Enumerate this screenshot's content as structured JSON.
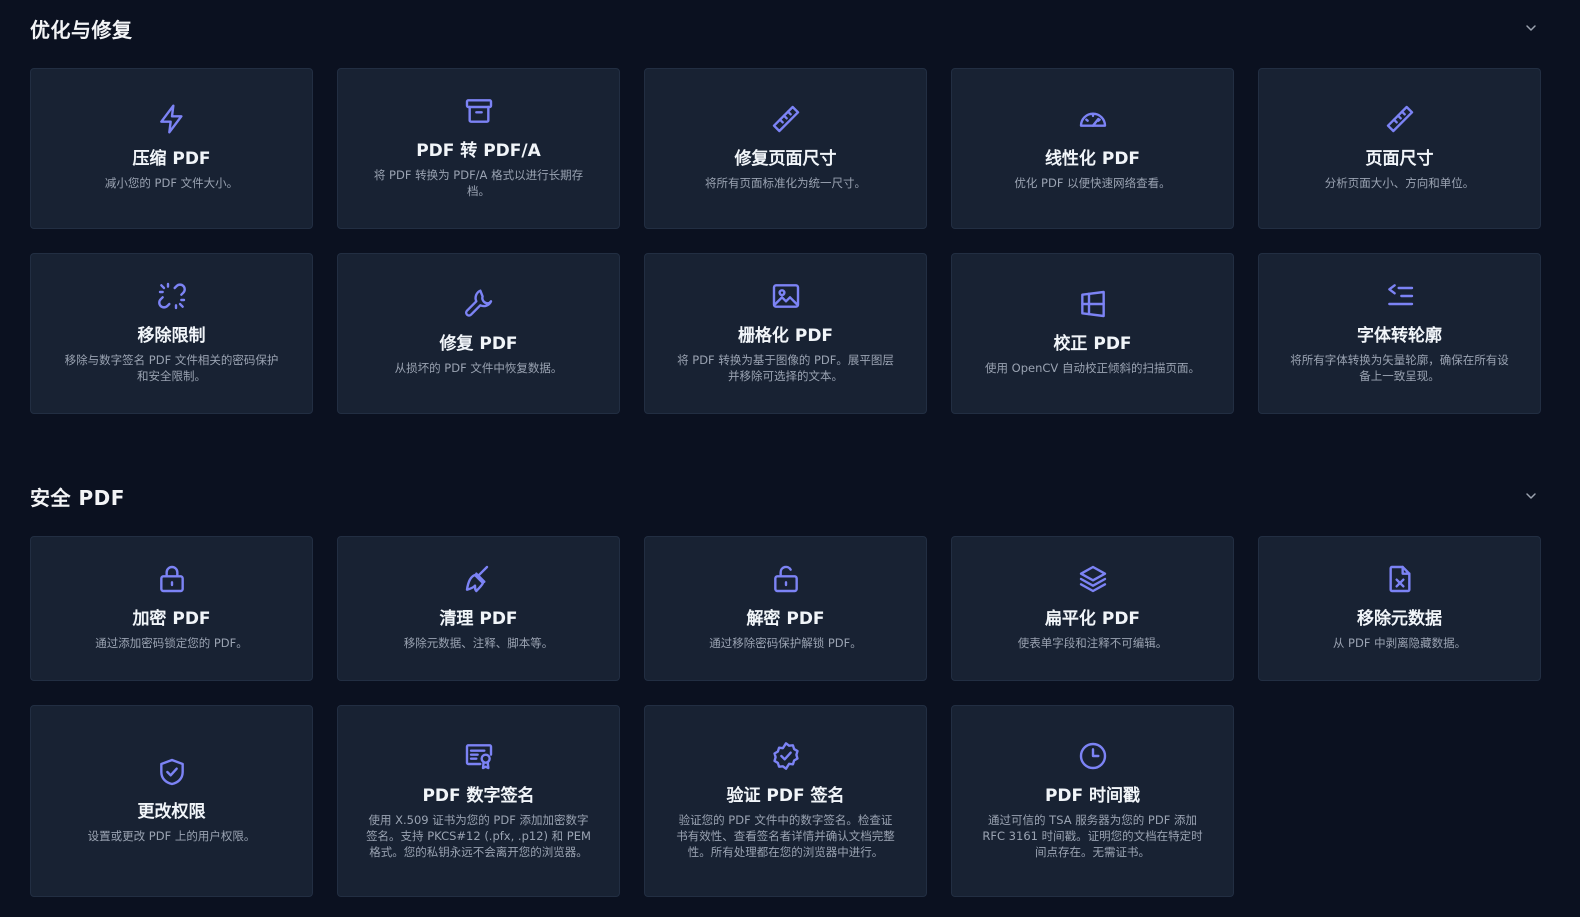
{
  "sections": [
    {
      "title": "优化与修复",
      "cards": [
        {
          "title": "压缩 PDF",
          "desc": "减小您的 PDF 文件大小。",
          "icon": "lightning-icon"
        },
        {
          "title": "PDF 转 PDF/A",
          "desc": "将 PDF 转换为 PDF/A 格式以进行长期存档。",
          "icon": "archive-icon"
        },
        {
          "title": "修复页面尺寸",
          "desc": "将所有页面标准化为统一尺寸。",
          "icon": "ruler-icon"
        },
        {
          "title": "线性化 PDF",
          "desc": "优化 PDF 以便快速网络查看。",
          "icon": "gauge-icon"
        },
        {
          "title": "页面尺寸",
          "desc": "分析页面大小、方向和单位。",
          "icon": "ruler-icon"
        },
        {
          "title": "移除限制",
          "desc": "移除与数字签名 PDF 文件相关的密码保护和安全限制。",
          "icon": "unlink-icon"
        },
        {
          "title": "修复 PDF",
          "desc": "从损坏的 PDF 文件中恢复数据。",
          "icon": "wrench-icon"
        },
        {
          "title": "栅格化 PDF",
          "desc": "将 PDF 转换为基于图像的 PDF。展平图层并移除可选择的文本。",
          "icon": "image-icon"
        },
        {
          "title": "校正 PDF",
          "desc": "使用 OpenCV 自动校正倾斜的扫描页面。",
          "icon": "perspective-icon"
        },
        {
          "title": "字体转轮廓",
          "desc": "将所有字体转换为矢量轮廓，确保在所有设备上一致呈现。",
          "icon": "indent-list-icon"
        }
      ]
    },
    {
      "title": "安全 PDF",
      "cards": [
        {
          "title": "加密 PDF",
          "desc": "通过添加密码锁定您的 PDF。",
          "icon": "lock-icon"
        },
        {
          "title": "清理 PDF",
          "desc": "移除元数据、注释、脚本等。",
          "icon": "broom-icon"
        },
        {
          "title": "解密 PDF",
          "desc": "通过移除密码保护解锁 PDF。",
          "icon": "unlock-icon"
        },
        {
          "title": "扁平化 PDF",
          "desc": "使表单字段和注释不可编辑。",
          "icon": "layers-icon"
        },
        {
          "title": "移除元数据",
          "desc": "从 PDF 中剥离隐藏数据。",
          "icon": "file-x-icon"
        },
        {
          "title": "更改权限",
          "desc": "设置或更改 PDF 上的用户权限。",
          "icon": "shield-check-icon"
        },
        {
          "title": "PDF 数字签名",
          "desc": "使用 X.509 证书为您的 PDF 添加加密数字签名。支持 PKCS#12 (.pfx, .p12) 和 PEM 格式。您的私钥永远不会离开您的浏览器。",
          "icon": "certificate-icon"
        },
        {
          "title": "验证 PDF 签名",
          "desc": "验证您的 PDF 文件中的数字签名。检查证书有效性、查看签名者详情并确认文档完整性。所有处理都在您的浏览器中进行。",
          "icon": "badge-check-icon"
        },
        {
          "title": "PDF 时间戳",
          "desc": "通过可信的 TSA 服务器为您的 PDF 添加 RFC 3161 时间戳。证明您的文档在特定时间点存在。无需证书。",
          "icon": "clock-icon"
        }
      ]
    }
  ]
}
